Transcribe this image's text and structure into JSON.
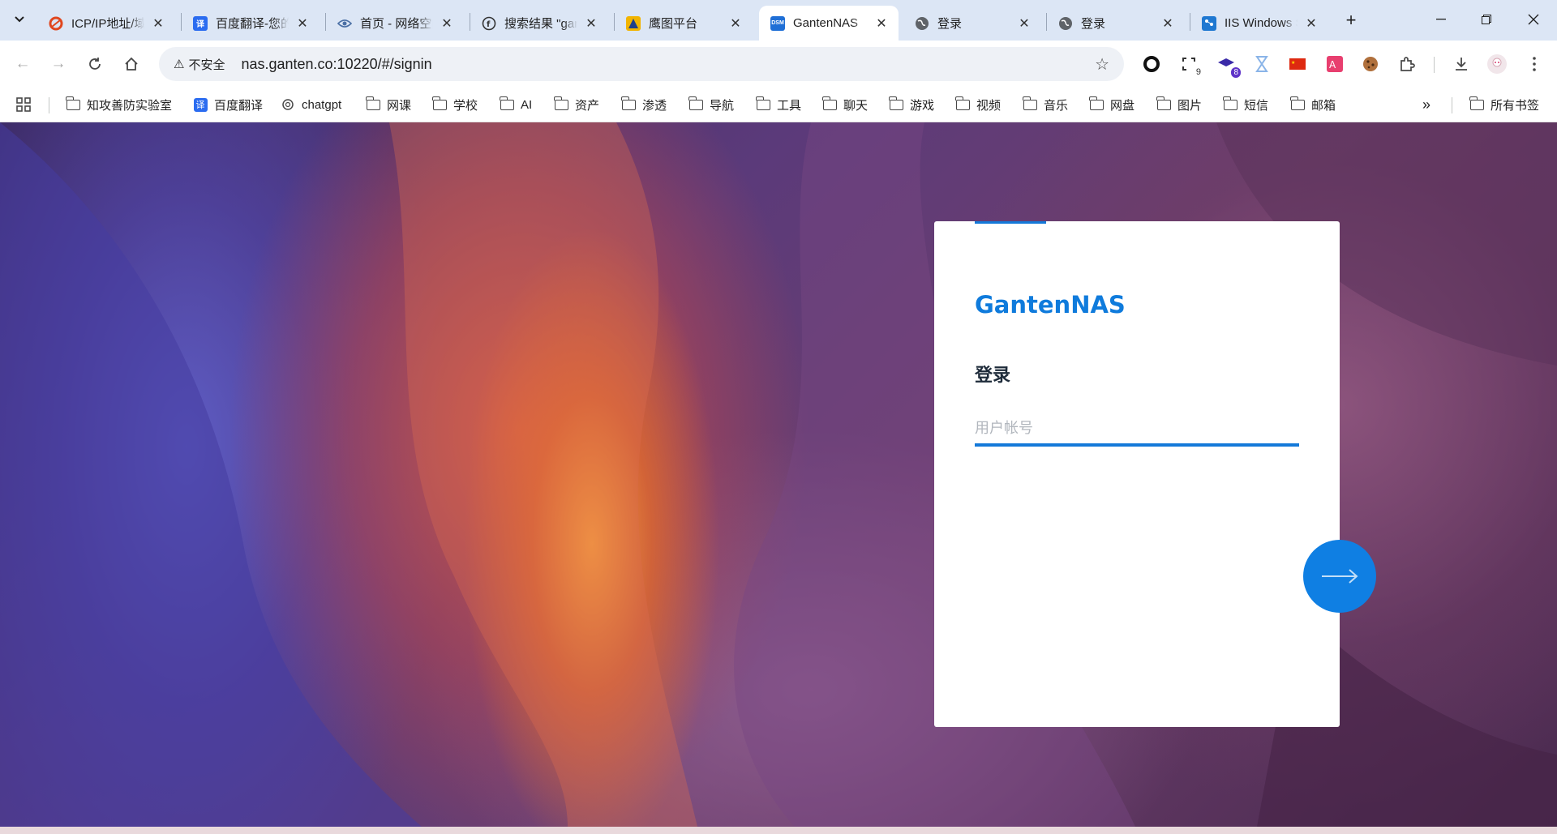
{
  "browser": {
    "tabs": [
      {
        "title": "ICP/IP地址/域名信息备案管理系统",
        "favicon": "icp-favicon-icon",
        "color": "#e0471f"
      },
      {
        "title": "百度翻译-您的超级翻译伙伴",
        "favicon": "baidu-translate-icon",
        "color": "#2b6cf0",
        "glyph": "译"
      },
      {
        "title": "首页 - 网络空间测绘",
        "favicon": "eye-icon",
        "color": "#4a6fa5"
      },
      {
        "title": "搜索结果 \"gantennas\"",
        "favicon": "fofa-icon",
        "color": "#333333"
      },
      {
        "title": "鹰图平台",
        "favicon": "hunter-icon",
        "color": "#f2b400"
      },
      {
        "title": "GantenNAS",
        "favicon": "dsm-icon",
        "color": "#1f6fd6",
        "glyph": "DSM",
        "active": true
      },
      {
        "title": "登录",
        "favicon": "globe-icon",
        "color": "#5f6368"
      },
      {
        "title": "登录",
        "favicon": "globe-icon",
        "color": "#5f6368"
      },
      {
        "title": "IIS Windows Server",
        "favicon": "iis-icon",
        "color": "#1f78d1"
      }
    ],
    "address_bar": {
      "security_label": "不安全",
      "url": "nas.ganten.co:10220/#/signin"
    },
    "extension_badges": {
      "second": "9",
      "third": "8"
    },
    "bookmarks": [
      {
        "label": "知攻善防实验室",
        "type": "folder"
      },
      {
        "label": "百度翻译",
        "type": "link"
      },
      {
        "label": "chatgpt",
        "type": "link"
      },
      {
        "label": "网课",
        "type": "folder"
      },
      {
        "label": "学校",
        "type": "folder"
      },
      {
        "label": "AI",
        "type": "folder"
      },
      {
        "label": "资产",
        "type": "folder"
      },
      {
        "label": "渗透",
        "type": "folder"
      },
      {
        "label": "导航",
        "type": "folder"
      },
      {
        "label": "工具",
        "type": "folder"
      },
      {
        "label": "聊天",
        "type": "folder"
      },
      {
        "label": "游戏",
        "type": "folder"
      },
      {
        "label": "视频",
        "type": "folder"
      },
      {
        "label": "音乐",
        "type": "folder"
      },
      {
        "label": "网盘",
        "type": "folder"
      },
      {
        "label": "图片",
        "type": "folder"
      },
      {
        "label": "短信",
        "type": "folder"
      },
      {
        "label": "邮箱",
        "type": "folder"
      }
    ],
    "all_bookmarks_label": "所有书签"
  },
  "login": {
    "brand": "GantenNAS",
    "title": "登录",
    "username_placeholder": "用户帐号",
    "username_value": "",
    "accent_color": "#1479d9"
  }
}
